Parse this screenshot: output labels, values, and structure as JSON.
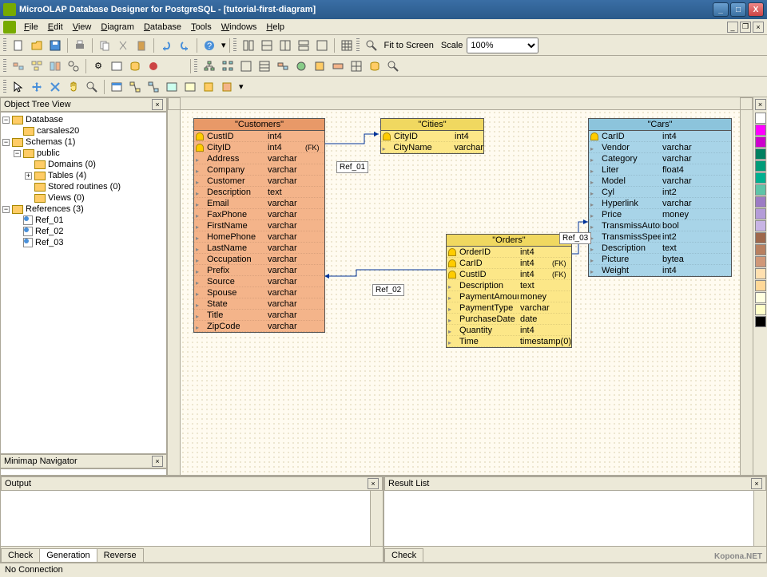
{
  "title": "MicroOLAP Database Designer for PostgreSQL - [tutorial-first-diagram]",
  "menu": [
    "File",
    "Edit",
    "View",
    "Diagram",
    "Database",
    "Tools",
    "Windows",
    "Help"
  ],
  "toolbar2": {
    "fit": "Fit to Screen",
    "scale_label": "Scale",
    "scale": "100%"
  },
  "tree": {
    "title": "Object Tree View",
    "root": "Database",
    "db": "carsales20",
    "schemas": "Schemas (1)",
    "public": "public",
    "domains": "Domains (0)",
    "tables": "Tables (4)",
    "sr": "Stored routines (0)",
    "views": "Views (0)",
    "refs": "References (3)",
    "ref": [
      "Ref_01",
      "Ref_02",
      "Ref_03"
    ]
  },
  "minimap": {
    "title": "Minimap Navigator"
  },
  "tables": {
    "customers": {
      "title": "\"Customers\"",
      "cols": [
        [
          "CustID",
          "int4",
          "pk",
          ""
        ],
        [
          "CityID",
          "int4",
          "pk",
          "(FK)"
        ],
        [
          "Address",
          "varchar",
          "",
          ""
        ],
        [
          "Company",
          "varchar",
          "",
          ""
        ],
        [
          "Customer",
          "varchar",
          "",
          ""
        ],
        [
          "Description",
          "text",
          "",
          ""
        ],
        [
          "Email",
          "varchar",
          "",
          ""
        ],
        [
          "FaxPhone",
          "varchar",
          "",
          ""
        ],
        [
          "FirstName",
          "varchar",
          "",
          ""
        ],
        [
          "HomePhone",
          "varchar",
          "",
          ""
        ],
        [
          "LastName",
          "varchar",
          "",
          ""
        ],
        [
          "Occupation",
          "varchar",
          "",
          ""
        ],
        [
          "Prefix",
          "varchar",
          "",
          ""
        ],
        [
          "Source",
          "varchar",
          "",
          ""
        ],
        [
          "Spouse",
          "varchar",
          "",
          ""
        ],
        [
          "State",
          "varchar",
          "",
          ""
        ],
        [
          "Title",
          "varchar",
          "",
          ""
        ],
        [
          "ZipCode",
          "varchar",
          "",
          ""
        ]
      ]
    },
    "cities": {
      "title": "\"Cities\"",
      "cols": [
        [
          "CityID",
          "int4",
          "pk",
          ""
        ],
        [
          "CityName",
          "varchar",
          "",
          ""
        ]
      ]
    },
    "orders": {
      "title": "\"Orders\"",
      "cols": [
        [
          "OrderID",
          "int4",
          "pk",
          ""
        ],
        [
          "CarID",
          "int4",
          "pk",
          "(FK)"
        ],
        [
          "CustID",
          "int4",
          "pk",
          "(FK)"
        ],
        [
          "Description",
          "text",
          "",
          ""
        ],
        [
          "PaymentAmount",
          "money",
          "",
          ""
        ],
        [
          "PaymentType",
          "varchar",
          "",
          ""
        ],
        [
          "PurchaseDate",
          "date",
          "",
          ""
        ],
        [
          "Quantity",
          "int4",
          "",
          ""
        ],
        [
          "Time",
          "timestamp(0)",
          "",
          ""
        ]
      ]
    },
    "cars": {
      "title": "\"Cars\"",
      "cols": [
        [
          "CarID",
          "int4",
          "pk",
          ""
        ],
        [
          "Vendor",
          "varchar",
          "",
          ""
        ],
        [
          "Category",
          "varchar",
          "",
          ""
        ],
        [
          "Liter",
          "float4",
          "",
          ""
        ],
        [
          "Model",
          "varchar",
          "",
          ""
        ],
        [
          "Cyl",
          "int2",
          "",
          ""
        ],
        [
          "Hyperlink",
          "varchar",
          "",
          ""
        ],
        [
          "Price",
          "money",
          "",
          ""
        ],
        [
          "TransmissAutomatic",
          "bool",
          "",
          ""
        ],
        [
          "TransmissSpeedCount",
          "int2",
          "",
          ""
        ],
        [
          "Description",
          "text",
          "",
          ""
        ],
        [
          "Picture",
          "bytea",
          "",
          ""
        ],
        [
          "Weight",
          "int4",
          "",
          ""
        ]
      ]
    }
  },
  "refs": {
    "r1": "Ref_01",
    "r2": "Ref_02",
    "r3": "Ref_03"
  },
  "output": {
    "title": "Output",
    "tabs": [
      "Check",
      "Generation",
      "Reverse"
    ],
    "active": 1
  },
  "result": {
    "title": "Result List",
    "tabs": [
      "Check"
    ],
    "active": 0
  },
  "status": "No Connection",
  "watermark": "Kopona.NET",
  "palette": [
    "#ffffff",
    "#ff00ff",
    "#cc00cc",
    "#008060",
    "#009c78",
    "#00b090",
    "#5ec4a8",
    "#9c7bc4",
    "#b49cd8",
    "#c8b4e4",
    "#9e684c",
    "#b88060",
    "#d09878",
    "#ffe0b0",
    "#ffd898",
    "#ffffe0",
    "#ffffc8",
    "#000000"
  ]
}
